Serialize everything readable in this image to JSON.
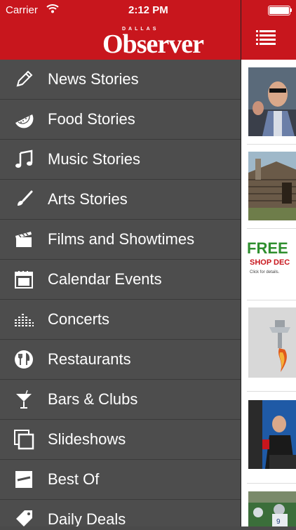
{
  "status_bar": {
    "carrier": "Carrier",
    "time": "2:12 PM"
  },
  "brand": {
    "logo_small": "DALLAS",
    "logo_main": "Observer",
    "accent": "#c8161d"
  },
  "menu": {
    "items": [
      {
        "label": "News Stories",
        "icon": "pencil-icon"
      },
      {
        "label": "Food Stories",
        "icon": "watermelon-icon"
      },
      {
        "label": "Music Stories",
        "icon": "music-note-icon"
      },
      {
        "label": "Arts Stories",
        "icon": "paintbrush-icon"
      },
      {
        "label": "Films and Showtimes",
        "icon": "clapperboard-icon"
      },
      {
        "label": "Calendar Events",
        "icon": "calendar-icon"
      },
      {
        "label": "Concerts",
        "icon": "equalizer-icon"
      },
      {
        "label": "Restaurants",
        "icon": "fork-knife-icon"
      },
      {
        "label": "Bars & Clubs",
        "icon": "cocktail-icon"
      },
      {
        "label": "Slideshows",
        "icon": "slideshow-icon"
      },
      {
        "label": "Best Of",
        "icon": "best-of-icon"
      },
      {
        "label": "Daily Deals",
        "icon": "tag-icon"
      }
    ]
  },
  "content": {
    "ad": {
      "headline": "FREE",
      "subline": "SHOP DEC",
      "small": "Click for details."
    }
  }
}
